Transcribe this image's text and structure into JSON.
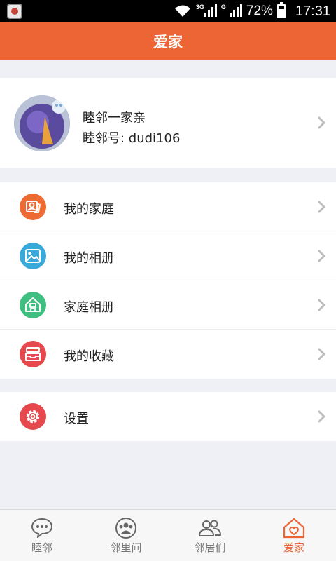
{
  "status_bar": {
    "network_1": "3G",
    "network_2": "G",
    "battery": "72%",
    "time": "17:31",
    "icons": [
      "app-icon",
      "wifi-icon",
      "signal-icon",
      "battery-icon"
    ]
  },
  "header": {
    "title": "爱家"
  },
  "profile": {
    "name": "睦邻一家亲",
    "account": "睦邻号: dudi106"
  },
  "menu": {
    "group1": [
      {
        "label": "我的家庭",
        "icon": "family-card-icon",
        "color": "#ee6a33"
      },
      {
        "label": "我的相册",
        "icon": "photo-icon",
        "color": "#38a9d8"
      },
      {
        "label": "家庭相册",
        "icon": "home-icon",
        "color": "#3fbf7f"
      },
      {
        "label": "我的收藏",
        "icon": "tray-icon",
        "color": "#e5484d"
      }
    ],
    "group2": [
      {
        "label": "设置",
        "icon": "gear-icon",
        "color": "#e5484d"
      }
    ]
  },
  "tabs": [
    {
      "label": "睦邻",
      "icon": "chat-bubble-icon",
      "active": false
    },
    {
      "label": "邻里间",
      "icon": "group-icon",
      "active": false
    },
    {
      "label": "邻居们",
      "icon": "people-icon",
      "active": false
    },
    {
      "label": "爱家",
      "icon": "heart-home-icon",
      "active": true
    }
  ],
  "colors": {
    "accent": "#ed6535",
    "background": "#eef0f5",
    "tab_inactive": "#777777"
  }
}
